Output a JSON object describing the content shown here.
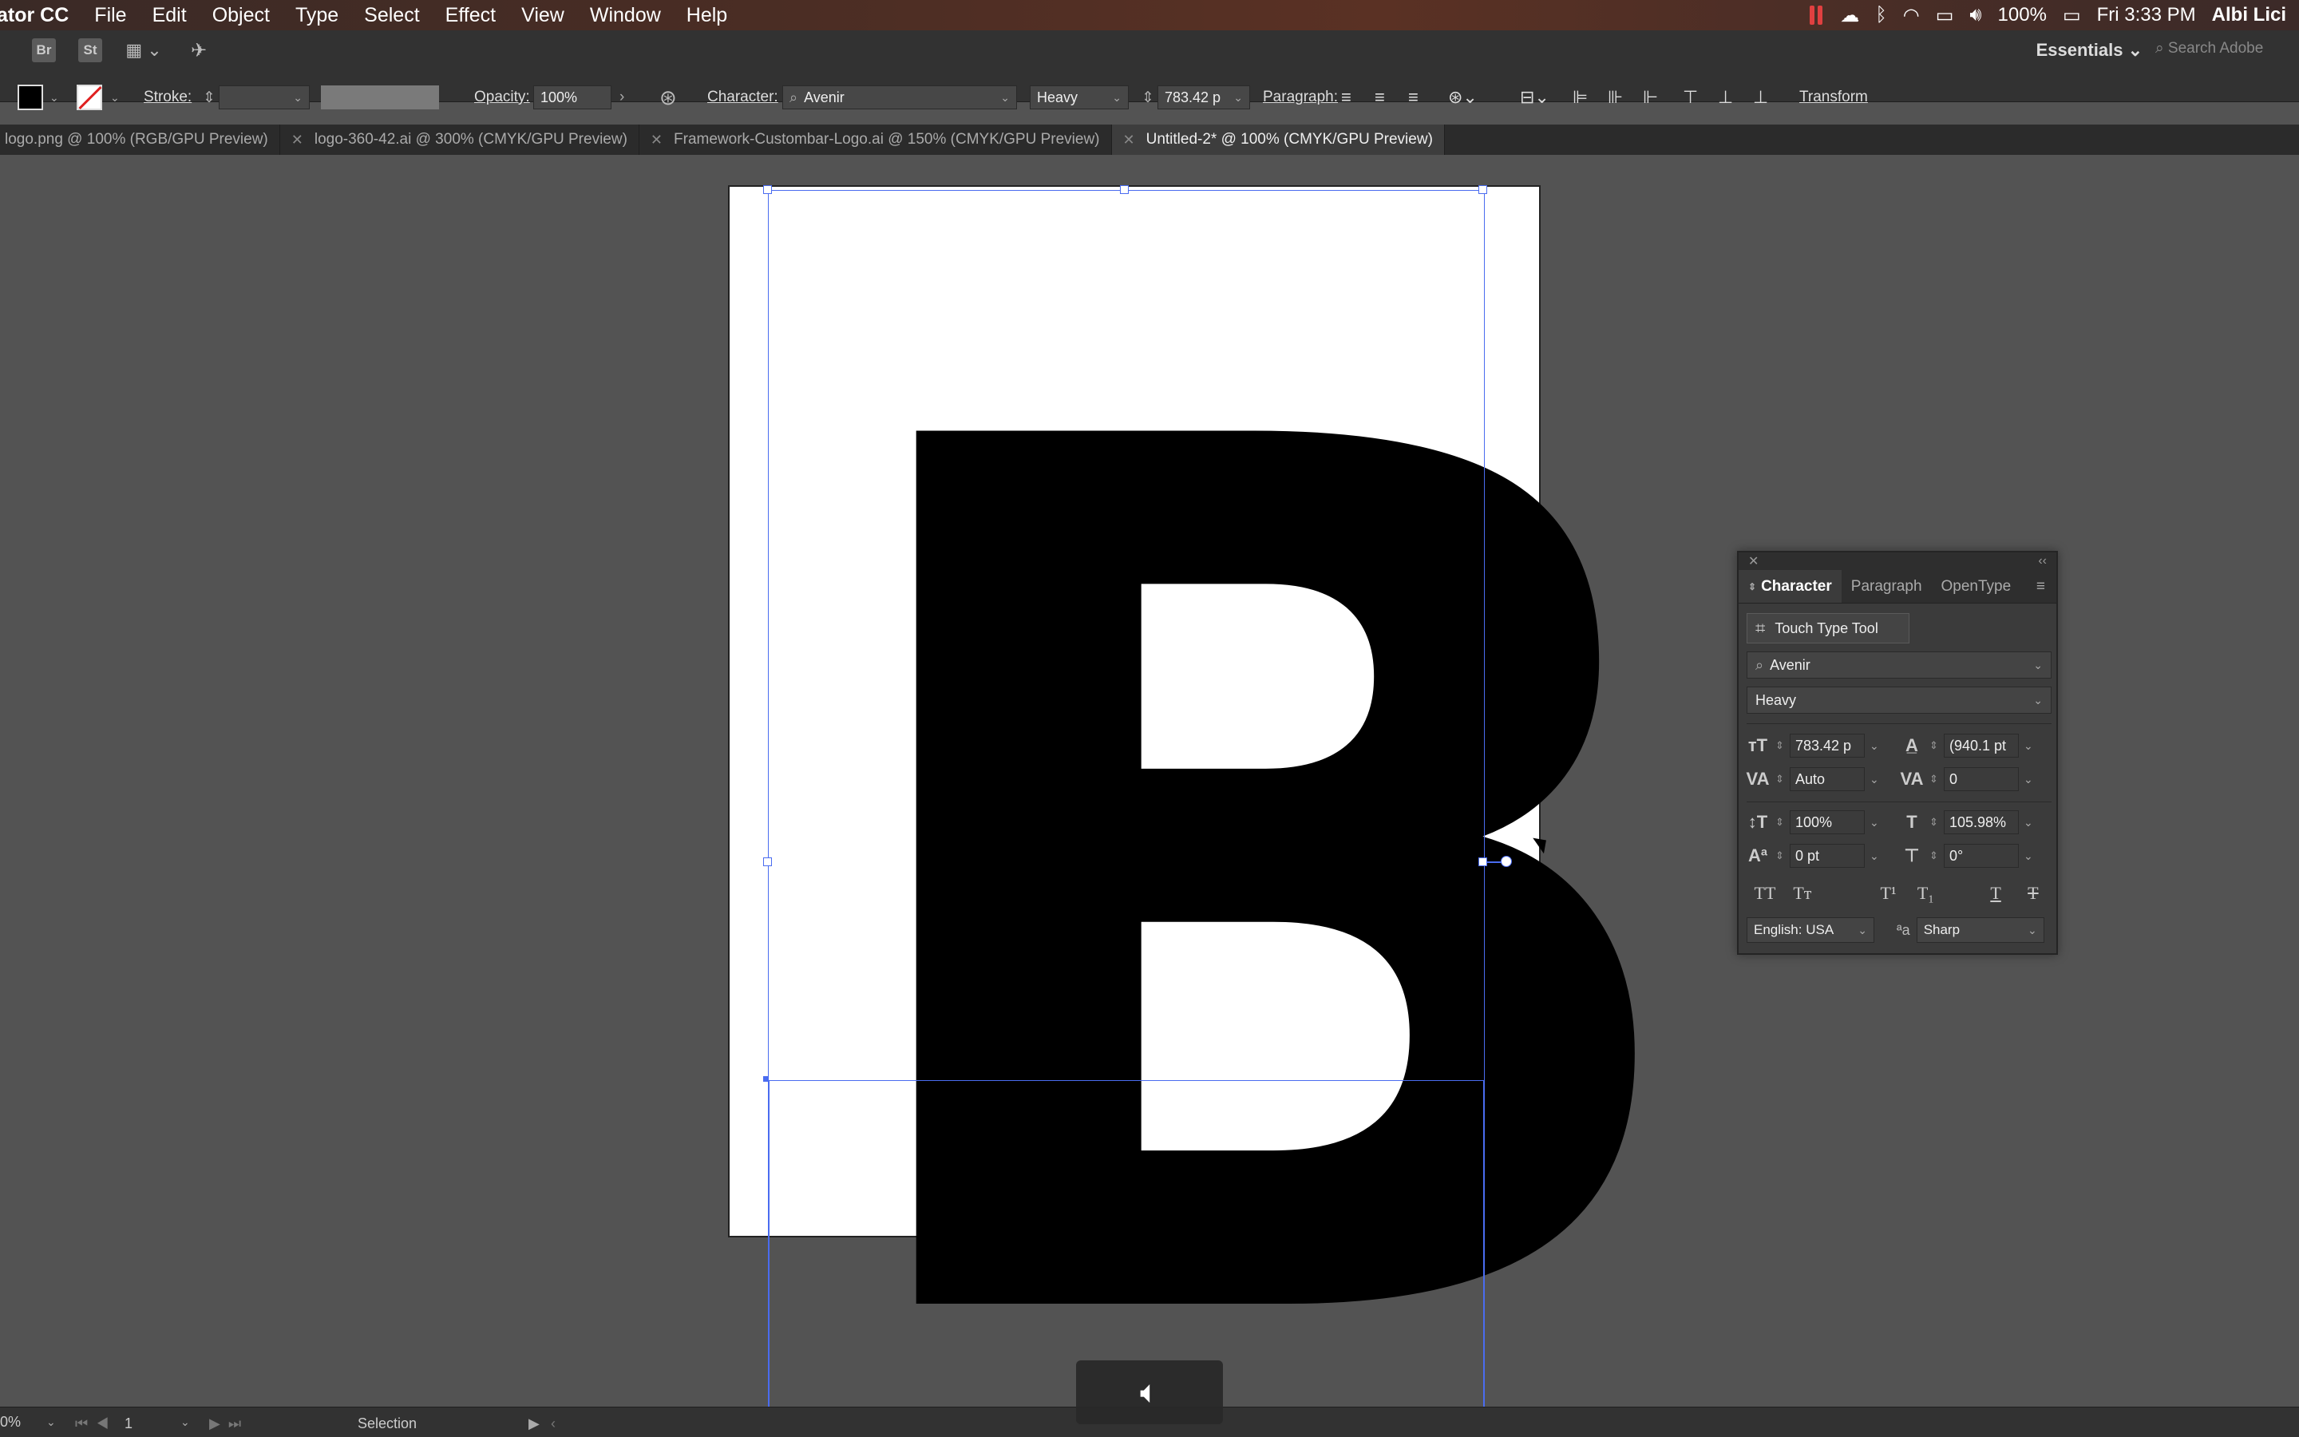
{
  "menubar": {
    "app_name": "ator CC",
    "items": [
      "File",
      "Edit",
      "Object",
      "Type",
      "Select",
      "Effect",
      "View",
      "Window",
      "Help"
    ],
    "battery": "100%",
    "clock": "Fri 3:33 PM",
    "user": "Albi Lici"
  },
  "toolbar": {
    "bridge": "Br",
    "stock": "St",
    "workspace": "Essentials",
    "search_placeholder": "Search Adobe"
  },
  "control": {
    "stroke_label": "Stroke:",
    "opacity_label": "Opacity:",
    "opacity_value": "100%",
    "character_label": "Character:",
    "font": "Avenir",
    "weight": "Heavy",
    "size": "783.42 p",
    "paragraph_label": "Paragraph:",
    "transform_label": "Transform"
  },
  "tabs": [
    {
      "label": "logo.png @ 100% (RGB/GPU Preview)"
    },
    {
      "label": "logo-360-42.ai @ 300% (CMYK/GPU Preview)"
    },
    {
      "label": "Framework-Custombar-Logo.ai @ 150% (CMYK/GPU Preview)"
    },
    {
      "label": "Untitled-2* @ 100% (CMYK/GPU Preview)"
    }
  ],
  "canvas": {
    "glyph": "B"
  },
  "character_panel": {
    "tabs": [
      "Character",
      "Paragraph",
      "OpenType"
    ],
    "touch_type": "Touch Type Tool",
    "font": "Avenir",
    "weight": "Heavy",
    "font_size": "783.42 p",
    "leading": "(940.1 pt",
    "kerning": "Auto",
    "tracking": "0",
    "vertical_scale": "100%",
    "horizontal_scale": "105.98%",
    "baseline_shift": "0 pt",
    "rotation": "0°",
    "language": "English: USA",
    "antialias": "Sharp",
    "aa_label": "ªa"
  },
  "statusbar": {
    "zoom": "0%",
    "page": "1",
    "mode": "Selection"
  }
}
